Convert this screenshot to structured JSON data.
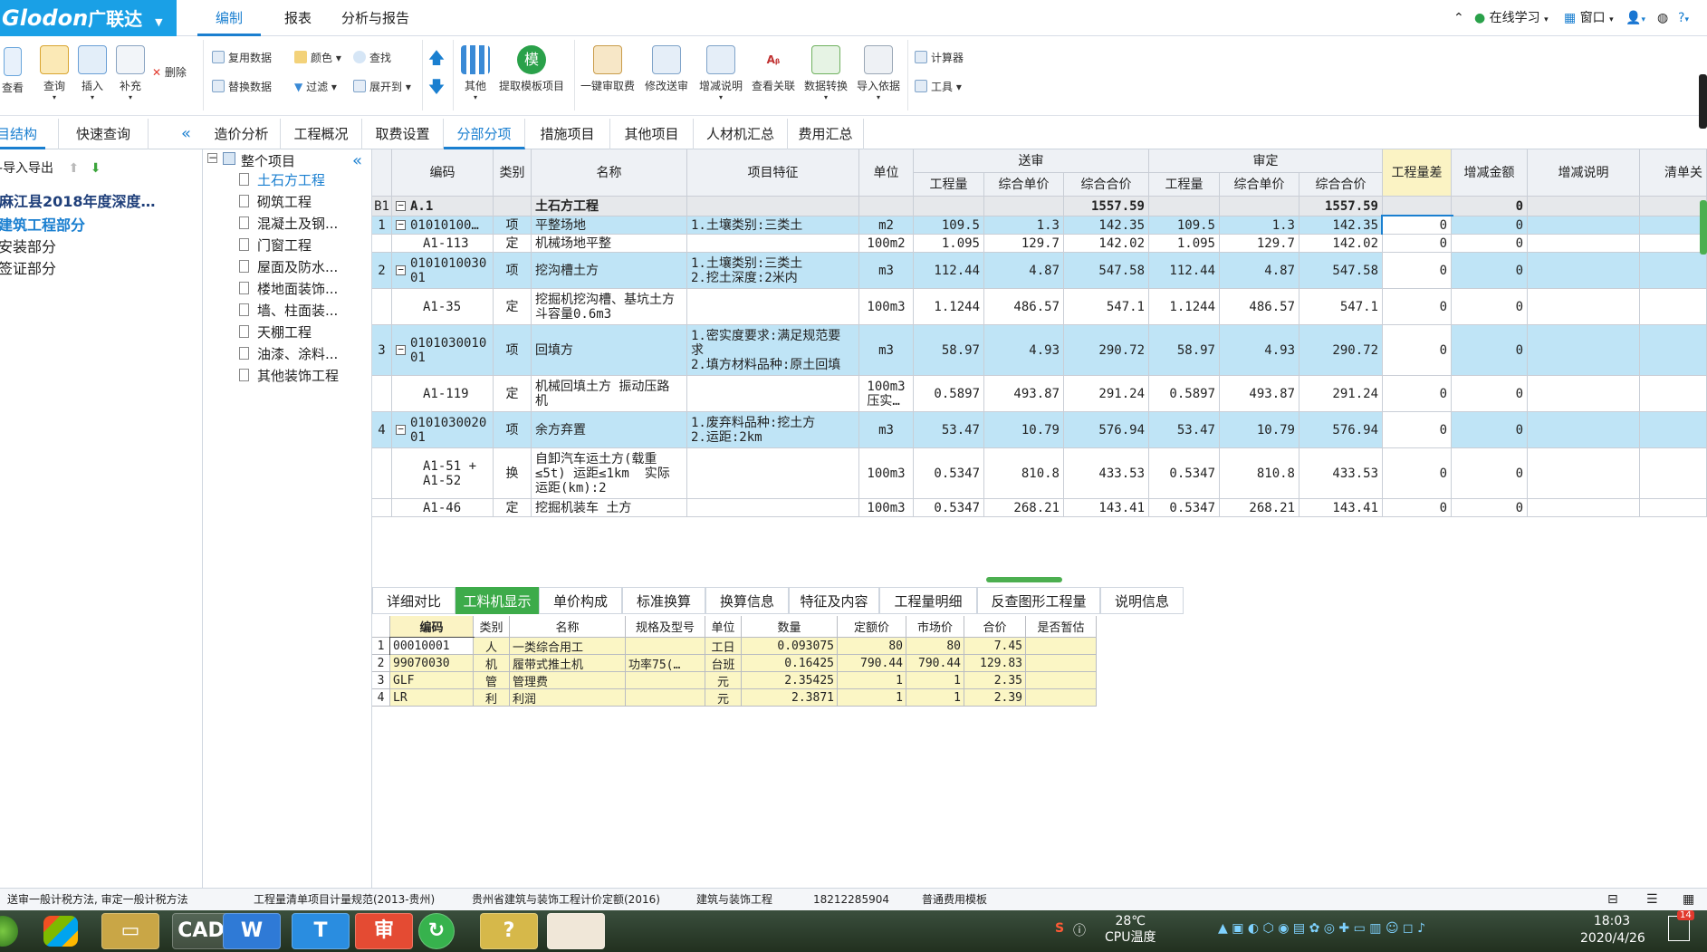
{
  "app": {
    "logo_text": "Glodon",
    "logo_cn": "广联达",
    "menu_tabs": [
      "编制",
      "报表",
      "分析与报告"
    ],
    "right": [
      "在线学习",
      "窗口",
      "?"
    ]
  },
  "toolbar": {
    "big_buttons": [
      "查看",
      "查询",
      "插入",
      "补充",
      "其他",
      "提取模板项目",
      "一键审取费",
      "修改送审",
      "增减说明",
      "查看关联",
      "数据转换",
      "导入依据"
    ],
    "small_buttons": {
      "delete": "删除",
      "reuse": "复用数据",
      "replace": "替换数据",
      "color": "颜色",
      "find": "查找",
      "filter": "过滤",
      "expand": "展开到",
      "calculator": "计算器",
      "tools": "工具"
    },
    "mo_icon_char": "模"
  },
  "left": {
    "tabs": [
      "项目结构",
      "快速查询"
    ],
    "import_export": "导入导出",
    "items": [
      "麻江县2018年度深度…",
      "建筑工程部分",
      "安装部分",
      "签证部分"
    ]
  },
  "tree": {
    "root": "整个项目",
    "items": [
      "土石方工程",
      "砌筑工程",
      "混凝土及钢...",
      "门窗工程",
      "屋面及防水...",
      "楼地面装饰...",
      "墙、柱面装...",
      "天棚工程",
      "油漆、涂料...",
      "其他装饰工程"
    ]
  },
  "main_tabs": [
    "造价分析",
    "工程概况",
    "取费设置",
    "分部分项",
    "措施项目",
    "其他项目",
    "人材机汇总",
    "费用汇总"
  ],
  "grid": {
    "headers": {
      "code": "编码",
      "type": "类别",
      "name": "名称",
      "feature": "项目特征",
      "unit": "单位",
      "song_shen": "送审",
      "shen_ding": "审定",
      "qty": "工程量",
      "price": "综合单价",
      "total": "综合合价",
      "diff": "工程量差",
      "inc_amt": "增减金额",
      "inc_note": "增减说明",
      "list": "清单关"
    },
    "rows": [
      {
        "no": "B1",
        "code": "A.1",
        "type": "",
        "name": "土石方工程",
        "feature": "",
        "unit": "",
        "q1": "",
        "p1": "",
        "t1": "1557.59",
        "q2": "",
        "p2": "",
        "t2": "1557.59",
        "diff": "",
        "amt": "0"
      },
      {
        "no": "1",
        "code": "01010100…",
        "type": "项",
        "name": "平整场地",
        "feature": "1.土壤类别:三类土",
        "unit": "m2",
        "q1": "109.5",
        "p1": "1.3",
        "t1": "142.35",
        "q2": "109.5",
        "p2": "1.3",
        "t2": "142.35",
        "diff": "0",
        "amt": "0"
      },
      {
        "no": "",
        "code": "A1-113",
        "type": "定",
        "name": "机械场地平整",
        "feature": "",
        "unit": "100m2",
        "q1": "1.095",
        "p1": "129.7",
        "t1": "142.02",
        "q2": "1.095",
        "p2": "129.7",
        "t2": "142.02",
        "diff": "0",
        "amt": "0"
      },
      {
        "no": "2",
        "code": "0101010030\n01",
        "type": "项",
        "name": "挖沟槽土方",
        "feature": "1.土壤类别:三类土\n2.挖土深度:2米内",
        "unit": "m3",
        "q1": "112.44",
        "p1": "4.87",
        "t1": "547.58",
        "q2": "112.44",
        "p2": "4.87",
        "t2": "547.58",
        "diff": "0",
        "amt": "0"
      },
      {
        "no": "",
        "code": "A1-35",
        "type": "定",
        "name": "挖掘机挖沟槽、基坑土方\n斗容量0.6m3",
        "feature": "",
        "unit": "100m3",
        "q1": "1.1244",
        "p1": "486.57",
        "t1": "547.1",
        "q2": "1.1244",
        "p2": "486.57",
        "t2": "547.1",
        "diff": "0",
        "amt": "0"
      },
      {
        "no": "3",
        "code": "0101030010\n01",
        "type": "项",
        "name": "回填方",
        "feature": "1.密实度要求:满足规范要\n求\n2.填方材料品种:原土回填",
        "unit": "m3",
        "q1": "58.97",
        "p1": "4.93",
        "t1": "290.72",
        "q2": "58.97",
        "p2": "4.93",
        "t2": "290.72",
        "diff": "0",
        "amt": "0"
      },
      {
        "no": "",
        "code": "A1-119",
        "type": "定",
        "name": "机械回填土方 振动压路\n机",
        "feature": "",
        "unit": "100m3\n压实…",
        "q1": "0.5897",
        "p1": "493.87",
        "t1": "291.24",
        "q2": "0.5897",
        "p2": "493.87",
        "t2": "291.24",
        "diff": "0",
        "amt": "0"
      },
      {
        "no": "4",
        "code": "0101030020\n01",
        "type": "项",
        "name": "余方弃置",
        "feature": "1.废弃料品种:挖土方\n2.运距:2km",
        "unit": "m3",
        "q1": "53.47",
        "p1": "10.79",
        "t1": "576.94",
        "q2": "53.47",
        "p2": "10.79",
        "t2": "576.94",
        "diff": "0",
        "amt": "0"
      },
      {
        "no": "",
        "code": "A1-51 +\nA1-52",
        "type": "换",
        "name": "自卸汽车运土方(载重\n≤5t) 运距≤1km  实际\n运距(km):2",
        "feature": "",
        "unit": "100m3",
        "q1": "0.5347",
        "p1": "810.8",
        "t1": "433.53",
        "q2": "0.5347",
        "p2": "810.8",
        "t2": "433.53",
        "diff": "0",
        "amt": "0"
      },
      {
        "no": "",
        "code": "A1-46",
        "type": "定",
        "name": "挖掘机装车 土方",
        "feature": "",
        "unit": "100m3",
        "q1": "0.5347",
        "p1": "268.21",
        "t1": "143.41",
        "q2": "0.5347",
        "p2": "268.21",
        "t2": "143.41",
        "diff": "0",
        "amt": "0"
      }
    ]
  },
  "bottom_tabs": [
    "详细对比",
    "工料机显示",
    "单价构成",
    "标准换算",
    "换算信息",
    "特征及内容",
    "工程量明细",
    "反查图形工程量",
    "说明信息"
  ],
  "sub_grid": {
    "headers": [
      "编码",
      "类别",
      "名称",
      "规格及型号",
      "单位",
      "数量",
      "定额价",
      "市场价",
      "合价",
      "是否暂估"
    ],
    "rows": [
      [
        "1",
        "00010001",
        "人",
        "一类综合用工",
        "",
        "工日",
        "0.093075",
        "80",
        "80",
        "7.45",
        ""
      ],
      [
        "2",
        "99070030",
        "机",
        "履带式推土机",
        "功率75(…",
        "台班",
        "0.16425",
        "790.44",
        "790.44",
        "129.83",
        ""
      ],
      [
        "3",
        "GLF",
        "管",
        "管理费",
        "",
        "元",
        "2.35425",
        "1",
        "1",
        "2.35",
        ""
      ],
      [
        "4",
        "LR",
        "利",
        "利润",
        "",
        "元",
        "2.3871",
        "1",
        "1",
        "2.39",
        ""
      ]
    ]
  },
  "status": [
    "计税方式：送审一般计税方法, 审定一般计税方法",
    "工程量清单项目计量规范(2013-贵州)",
    "贵州省建筑与装饰工程计价定额(2016)",
    "建筑与装饰工程",
    "18212285904",
    "普通费用模板"
  ],
  "taskbar": {
    "temp": "28℃",
    "temp_label": "CPU温度",
    "time": "18:03",
    "date": "2020/4/26",
    "badge": "14",
    "apps": [
      "CAD",
      "W",
      "T",
      "审"
    ]
  }
}
